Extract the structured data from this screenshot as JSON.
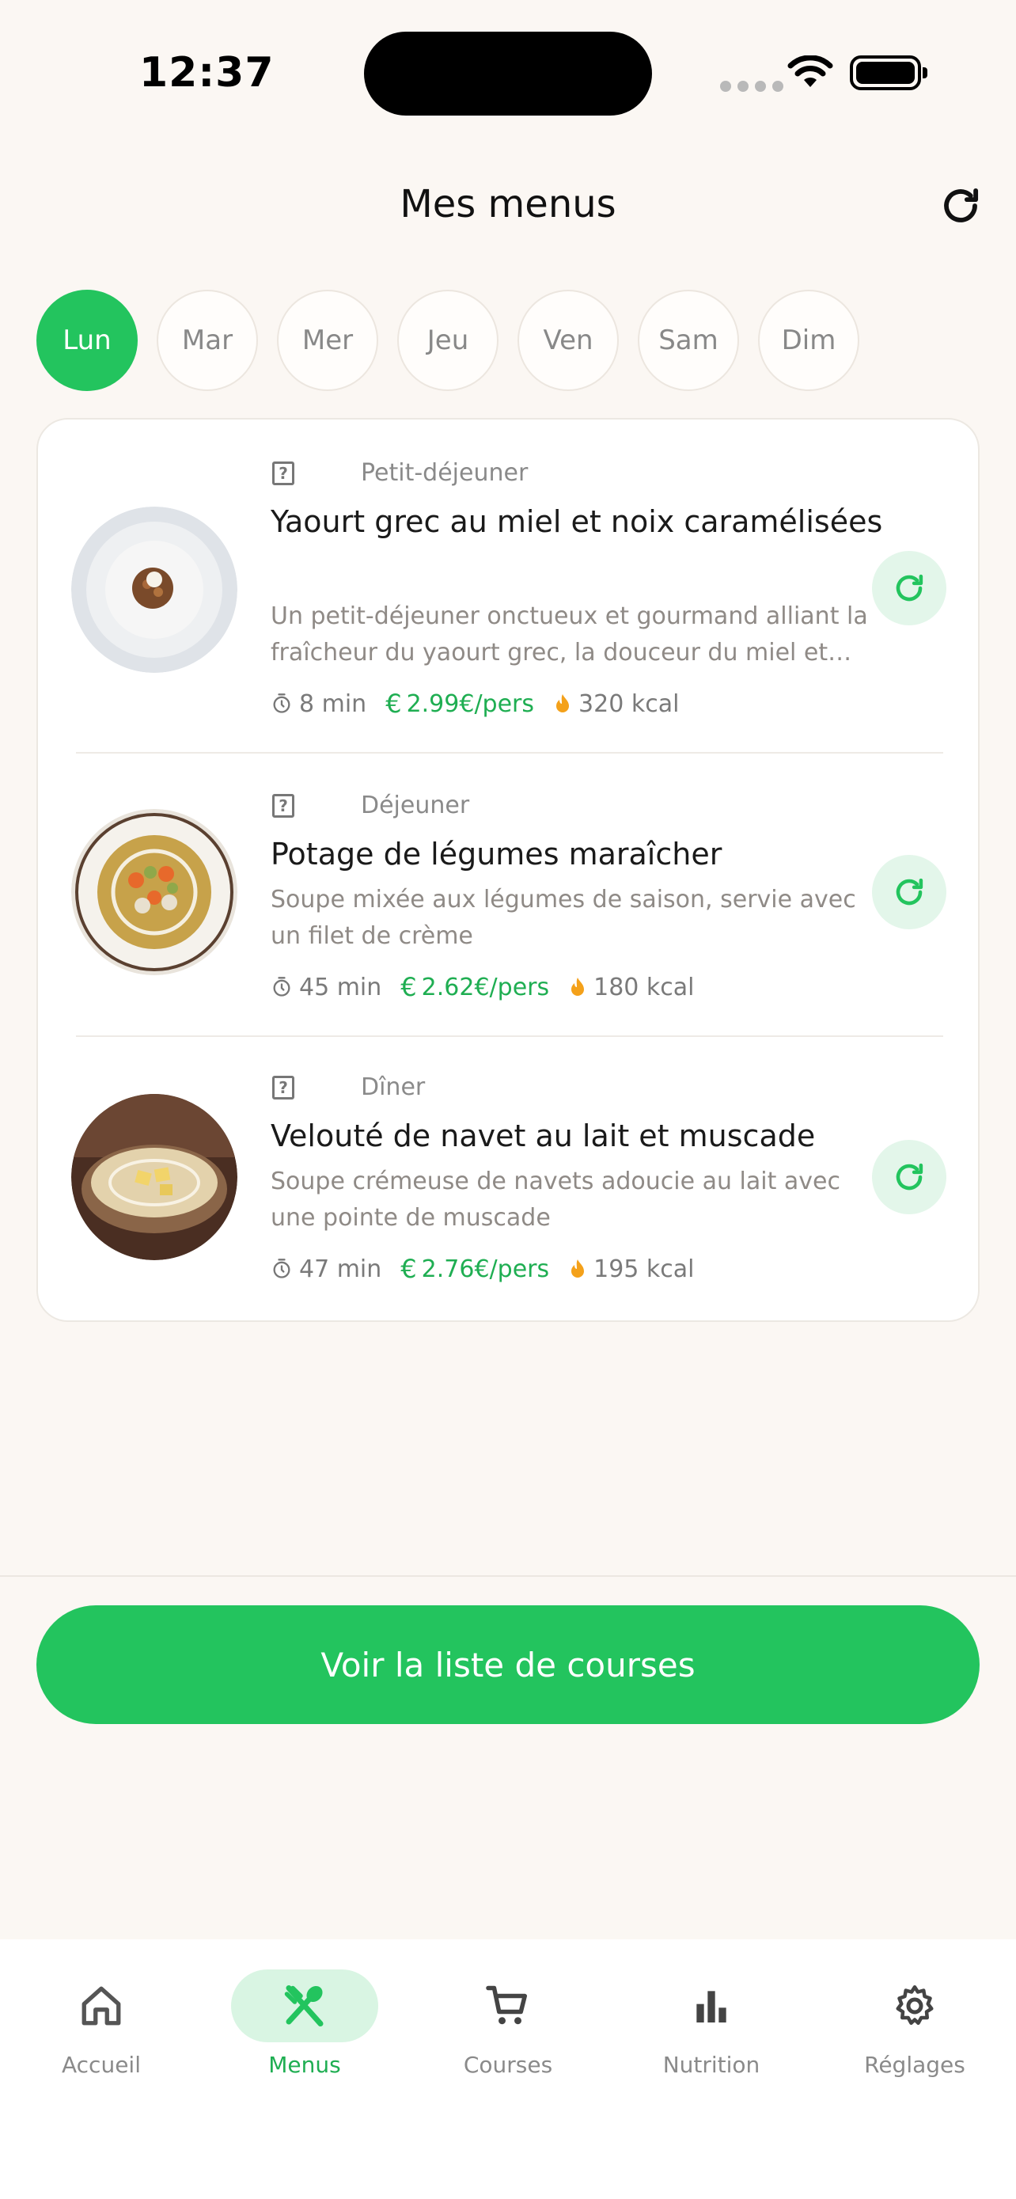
{
  "status_bar": {
    "time": "12:37"
  },
  "header": {
    "title": "Mes menus"
  },
  "days": [
    "Lun",
    "Mar",
    "Mer",
    "Jeu",
    "Ven",
    "Sam",
    "Dim"
  ],
  "active_day": "Lun",
  "meals": [
    {
      "type": "Petit-déjeuner",
      "title": "Yaourt grec au miel et noix caramélisées",
      "description": "Un petit-déjeuner onctueux et gourmand alliant la fraîcheur du yaourt grec, la douceur du miel et des noix caramélisées",
      "time": "8 min",
      "price": "2.99€/pers",
      "kcal": "320 kcal"
    },
    {
      "type": "Déjeuner",
      "title": "Potage de légumes maraîcher",
      "description": "Soupe mixée aux légumes de saison, servie avec un filet de crème",
      "time": "45 min",
      "price": "2.62€/pers",
      "kcal": "180 kcal"
    },
    {
      "type": "Dîner",
      "title": "Velouté de navet au lait et muscade",
      "description": "Soupe crémeuse de navets adoucie au lait avec une pointe de muscade",
      "time": "47 min",
      "price": "2.76€/pers",
      "kcal": "195 kcal"
    }
  ],
  "cta": {
    "label": "Voir la liste de courses"
  },
  "tabs": [
    {
      "label": "Accueil",
      "icon": "home-icon"
    },
    {
      "label": "Menus",
      "icon": "utensils-icon",
      "active": true
    },
    {
      "label": "Courses",
      "icon": "cart-icon"
    },
    {
      "label": "Nutrition",
      "icon": "bar-chart-icon"
    },
    {
      "label": "Réglages",
      "icon": "gear-icon"
    }
  ],
  "colors": {
    "accent": "#23c45e",
    "background": "#fbf7f3",
    "accent_light": "#e3f6ea"
  }
}
